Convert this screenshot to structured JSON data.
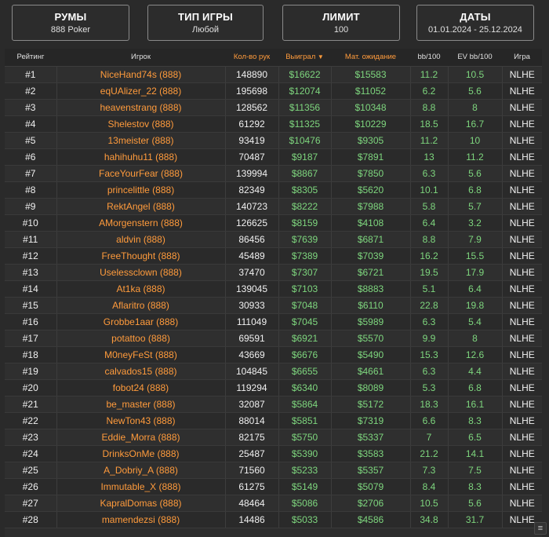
{
  "filters": [
    {
      "title": "РУМЫ",
      "value": "888 Poker"
    },
    {
      "title": "ТИП ИГРЫ",
      "value": "Любой"
    },
    {
      "title": "ЛИМИТ",
      "value": "100"
    },
    {
      "title": "ДАТЫ",
      "value": "01.01.2024 - 25.12.2024"
    }
  ],
  "table": {
    "headers": {
      "rank": "Рейтинг",
      "player": "Игрок",
      "hands": "Кол-во рук",
      "won": "Выиграл",
      "sort_icon": "▼",
      "ev": "Мат. ожидание",
      "bb100": "bb/100",
      "evbb100": "EV bb/100",
      "game": "Игра"
    },
    "rows": [
      {
        "rank": "#1",
        "player": "NiceHand74s (888)",
        "hands": "148890",
        "won": "$16622",
        "ev": "$15583",
        "bb": "11.2",
        "evbb": "10.5",
        "game": "NLHE"
      },
      {
        "rank": "#2",
        "player": "eqUAlizer_22 (888)",
        "hands": "195698",
        "won": "$12074",
        "ev": "$11052",
        "bb": "6.2",
        "evbb": "5.6",
        "game": "NLHE"
      },
      {
        "rank": "#3",
        "player": "heavenstrang (888)",
        "hands": "128562",
        "won": "$11356",
        "ev": "$10348",
        "bb": "8.8",
        "evbb": "8",
        "game": "NLHE"
      },
      {
        "rank": "#4",
        "player": "Shelestov (888)",
        "hands": "61292",
        "won": "$11325",
        "ev": "$10229",
        "bb": "18.5",
        "evbb": "16.7",
        "game": "NLHE"
      },
      {
        "rank": "#5",
        "player": "13meister (888)",
        "hands": "93419",
        "won": "$10476",
        "ev": "$9305",
        "bb": "11.2",
        "evbb": "10",
        "game": "NLHE"
      },
      {
        "rank": "#6",
        "player": "hahihuhu11 (888)",
        "hands": "70487",
        "won": "$9187",
        "ev": "$7891",
        "bb": "13",
        "evbb": "11.2",
        "game": "NLHE"
      },
      {
        "rank": "#7",
        "player": "FaceYourFear (888)",
        "hands": "139994",
        "won": "$8867",
        "ev": "$7850",
        "bb": "6.3",
        "evbb": "5.6",
        "game": "NLHE"
      },
      {
        "rank": "#8",
        "player": "princelittle (888)",
        "hands": "82349",
        "won": "$8305",
        "ev": "$5620",
        "bb": "10.1",
        "evbb": "6.8",
        "game": "NLHE"
      },
      {
        "rank": "#9",
        "player": "RektAngel (888)",
        "hands": "140723",
        "won": "$8222",
        "ev": "$7988",
        "bb": "5.8",
        "evbb": "5.7",
        "game": "NLHE"
      },
      {
        "rank": "#10",
        "player": "AMorgenstern (888)",
        "hands": "126625",
        "won": "$8159",
        "ev": "$4108",
        "bb": "6.4",
        "evbb": "3.2",
        "game": "NLHE"
      },
      {
        "rank": "#11",
        "player": "aldvin (888)",
        "hands": "86456",
        "won": "$7639",
        "ev": "$6871",
        "bb": "8.8",
        "evbb": "7.9",
        "game": "NLHE"
      },
      {
        "rank": "#12",
        "player": "FreeThought (888)",
        "hands": "45489",
        "won": "$7389",
        "ev": "$7039",
        "bb": "16.2",
        "evbb": "15.5",
        "game": "NLHE"
      },
      {
        "rank": "#13",
        "player": "Uselessclown (888)",
        "hands": "37470",
        "won": "$7307",
        "ev": "$6721",
        "bb": "19.5",
        "evbb": "17.9",
        "game": "NLHE"
      },
      {
        "rank": "#14",
        "player": "At1ka (888)",
        "hands": "139045",
        "won": "$7103",
        "ev": "$8883",
        "bb": "5.1",
        "evbb": "6.4",
        "game": "NLHE"
      },
      {
        "rank": "#15",
        "player": "Aflaritro (888)",
        "hands": "30933",
        "won": "$7048",
        "ev": "$6110",
        "bb": "22.8",
        "evbb": "19.8",
        "game": "NLHE"
      },
      {
        "rank": "#16",
        "player": "Grobbe1aar (888)",
        "hands": "111049",
        "won": "$7045",
        "ev": "$5989",
        "bb": "6.3",
        "evbb": "5.4",
        "game": "NLHE"
      },
      {
        "rank": "#17",
        "player": "potattoo (888)",
        "hands": "69591",
        "won": "$6921",
        "ev": "$5570",
        "bb": "9.9",
        "evbb": "8",
        "game": "NLHE"
      },
      {
        "rank": "#18",
        "player": "M0neyFeSt (888)",
        "hands": "43669",
        "won": "$6676",
        "ev": "$5490",
        "bb": "15.3",
        "evbb": "12.6",
        "game": "NLHE"
      },
      {
        "rank": "#19",
        "player": "calvados15 (888)",
        "hands": "104845",
        "won": "$6655",
        "ev": "$4661",
        "bb": "6.3",
        "evbb": "4.4",
        "game": "NLHE"
      },
      {
        "rank": "#20",
        "player": "fobot24 (888)",
        "hands": "119294",
        "won": "$6340",
        "ev": "$8089",
        "bb": "5.3",
        "evbb": "6.8",
        "game": "NLHE"
      },
      {
        "rank": "#21",
        "player": "be_master (888)",
        "hands": "32087",
        "won": "$5864",
        "ev": "$5172",
        "bb": "18.3",
        "evbb": "16.1",
        "game": "NLHE"
      },
      {
        "rank": "#22",
        "player": "NewTon43 (888)",
        "hands": "88014",
        "won": "$5851",
        "ev": "$7319",
        "bb": "6.6",
        "evbb": "8.3",
        "game": "NLHE"
      },
      {
        "rank": "#23",
        "player": "Eddie_Morra (888)",
        "hands": "82175",
        "won": "$5750",
        "ev": "$5337",
        "bb": "7",
        "evbb": "6.5",
        "game": "NLHE"
      },
      {
        "rank": "#24",
        "player": "DrinksOnMe (888)",
        "hands": "25487",
        "won": "$5390",
        "ev": "$3583",
        "bb": "21.2",
        "evbb": "14.1",
        "game": "NLHE"
      },
      {
        "rank": "#25",
        "player": "A_Dobriy_A (888)",
        "hands": "71560",
        "won": "$5233",
        "ev": "$5357",
        "bb": "7.3",
        "evbb": "7.5",
        "game": "NLHE"
      },
      {
        "rank": "#26",
        "player": "Immutable_X (888)",
        "hands": "61275",
        "won": "$5149",
        "ev": "$5079",
        "bb": "8.4",
        "evbb": "8.3",
        "game": "NLHE"
      },
      {
        "rank": "#27",
        "player": "KapralDomas (888)",
        "hands": "48464",
        "won": "$5086",
        "ev": "$2706",
        "bb": "10.5",
        "evbb": "5.6",
        "game": "NLHE"
      },
      {
        "rank": "#28",
        "player": "mamendezsi (888)",
        "hands": "14486",
        "won": "$5033",
        "ev": "$4586",
        "bb": "34.8",
        "evbb": "31.7",
        "game": "NLHE"
      }
    ]
  },
  "menu_icon": "≡"
}
